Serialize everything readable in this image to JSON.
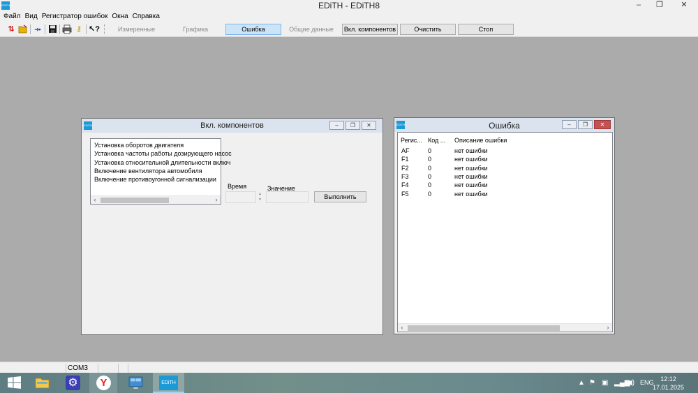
{
  "app": {
    "icon_text": "EDITH",
    "title": "EDiTH - EDiTH8",
    "controls": {
      "minimize": "–",
      "maximize": "❐",
      "close": "✕"
    }
  },
  "menu": [
    "Файл",
    "Вид",
    "Регистратор ошибок",
    "Окна",
    "Справка"
  ],
  "toolbar": {
    "icons": [
      "connect-icon",
      "open-folder-icon",
      "arrow-icon",
      "save-icon",
      "print-icon",
      "key-icon",
      "help-icon"
    ],
    "buttons": [
      {
        "label": "Измеренные значения",
        "state": "disabled"
      },
      {
        "label": "Графика",
        "state": "disabled"
      },
      {
        "label": "Ошибка",
        "state": "active"
      },
      {
        "label": "Общие данные",
        "state": "disabled"
      },
      {
        "label": "Вкл. компонентов",
        "state": "normal"
      },
      {
        "label": "Очистить",
        "state": "normal"
      },
      {
        "label": "Стоп",
        "state": "normal"
      }
    ]
  },
  "components_window": {
    "title": "Вкл. компонентов",
    "items": [
      "Установка оборотов двигателя",
      "Установка частоты работы дозирующего насос",
      "Установка относительной длительности включ",
      "Включение вентилятора автомобиля",
      "Включение противоугонной сигнализации"
    ],
    "time_label": "Время",
    "value_label": "Значение",
    "execute_label": "Выполнить"
  },
  "error_window": {
    "title": "Ошибка",
    "columns": [
      "Регис...",
      "Код ...",
      "Описание ошибки"
    ],
    "rows": [
      [
        "AF",
        "0",
        "нет ошибки"
      ],
      [
        "F1",
        "0",
        "нет ошибки"
      ],
      [
        "F2",
        "0",
        "нет ошибки"
      ],
      [
        "F3",
        "0",
        "нет ошибки"
      ],
      [
        "F4",
        "0",
        "нет ошибки"
      ],
      [
        "F5",
        "0",
        "нет ошибки"
      ]
    ]
  },
  "statusbar": {
    "port": "COM3"
  },
  "taskbar": {
    "apps": [
      "start-button",
      "file-explorer",
      "control-panel",
      "yandex-browser",
      "remote-desktop",
      "edith"
    ],
    "edith_label": "EDiTH",
    "language": "ENG",
    "time": "12:12",
    "date": "17.01.2025"
  },
  "colors": {
    "accent": "#1b9ad6",
    "mdi_background": "#ababab",
    "close_red": "#c75050"
  }
}
